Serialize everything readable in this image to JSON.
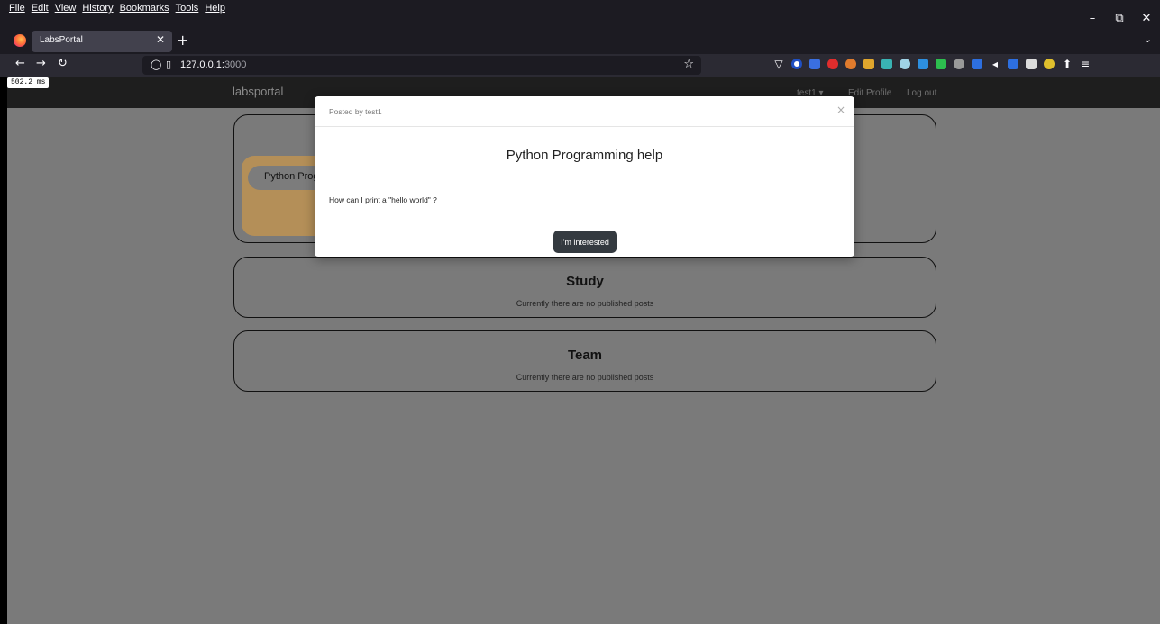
{
  "browser": {
    "menu": [
      "File",
      "Edit",
      "View",
      "History",
      "Bookmarks",
      "Tools",
      "Help"
    ],
    "window_controls": {
      "minimize": "–",
      "restore": "⧉",
      "close": "✕"
    },
    "tab": {
      "title": "LabsPortal",
      "close": "✕"
    },
    "new_tab": "+",
    "tab_list": "⌄",
    "nav": {
      "back": "←",
      "forward": "→",
      "reload": "↻"
    },
    "url": {
      "host": "127.0.0.1:",
      "port": "3000"
    },
    "bookmark_star": "☆",
    "toolbar_glyphs": {
      "share": "⬆",
      "menu": "≡"
    },
    "timing_badge": "502.2 ms"
  },
  "site": {
    "brand": "labsportal",
    "user_menu": "test1 ▾",
    "edit_profile": "Edit Profile",
    "logout": "Log out"
  },
  "sections": [
    {
      "heading": "",
      "post_preview": "Python Programming help"
    },
    {
      "heading": "Study",
      "empty_text": "Currently there are no published posts"
    },
    {
      "heading": "Team",
      "empty_text": "Currently there are no published posts"
    }
  ],
  "modal": {
    "posted_by": "Posted by test1",
    "close": "×",
    "title": "Python Programming help",
    "body": "How can I print a \"hello world\" ?",
    "button": "I'm interested"
  },
  "colors": {
    "overlay": "#7a7a7a",
    "card_accent": "#b48f58",
    "button_dark": "#343a40"
  }
}
